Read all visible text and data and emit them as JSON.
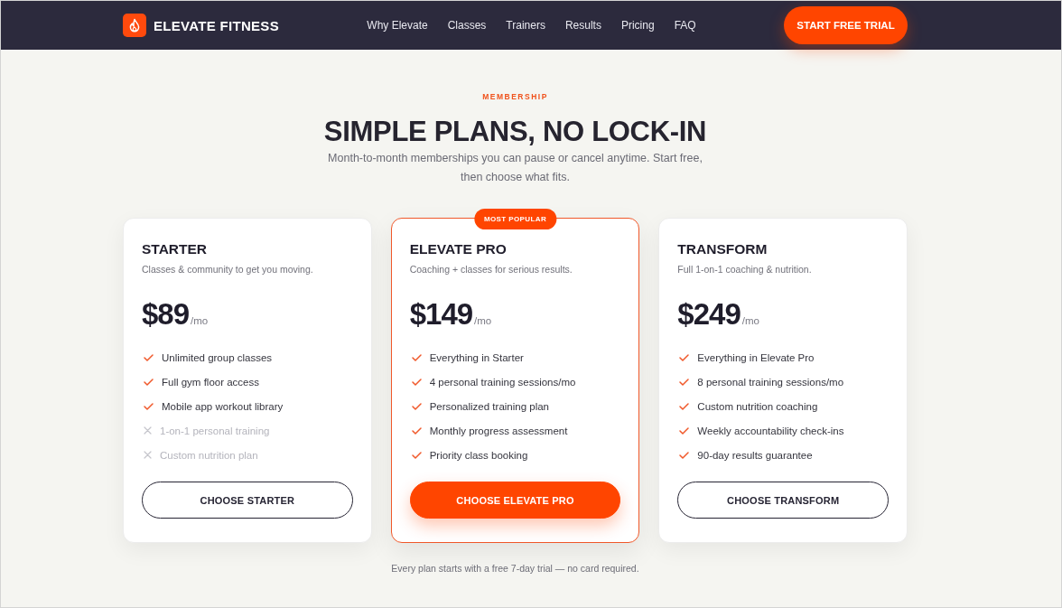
{
  "navbar": {
    "brand": "ELEVATE FITNESS",
    "links": [
      {
        "label": "Why Elevate"
      },
      {
        "label": "Classes"
      },
      {
        "label": "Trainers"
      },
      {
        "label": "Results"
      },
      {
        "label": "Pricing"
      },
      {
        "label": "FAQ"
      }
    ],
    "cta": "START FREE TRIAL"
  },
  "header": {
    "eyebrow": "MEMBERSHIP",
    "title": "SIMPLE PLANS, NO LOCK-IN",
    "subtitle": "Month-to-month memberships you can pause or cancel anytime. Start free, then choose what fits."
  },
  "plans": [
    {
      "name": "STARTER",
      "description": "Classes & community to get you moving.",
      "price": "$89",
      "period": "/mo",
      "featured": false,
      "features": [
        {
          "text": "Unlimited group classes",
          "included": true
        },
        {
          "text": "Full gym floor access",
          "included": true
        },
        {
          "text": "Mobile app workout library",
          "included": true
        },
        {
          "text": "1-on-1 personal training",
          "included": false
        },
        {
          "text": "Custom nutrition plan",
          "included": false
        }
      ],
      "button": "CHOOSE STARTER"
    },
    {
      "name": "ELEVATE PRO",
      "description": "Coaching + classes for serious results.",
      "price": "$149",
      "period": "/mo",
      "featured": true,
      "badge": "MOST POPULAR",
      "features": [
        {
          "text": "Everything in Starter",
          "included": true
        },
        {
          "text": "4 personal training sessions/mo",
          "included": true
        },
        {
          "text": "Personalized training plan",
          "included": true
        },
        {
          "text": "Monthly progress assessment",
          "included": true
        },
        {
          "text": "Priority class booking",
          "included": true
        }
      ],
      "button": "CHOOSE ELEVATE PRO"
    },
    {
      "name": "TRANSFORM",
      "description": "Full 1-on-1 coaching & nutrition.",
      "price": "$249",
      "period": "/mo",
      "featured": false,
      "features": [
        {
          "text": "Everything in Elevate Pro",
          "included": true
        },
        {
          "text": "8 personal training sessions/mo",
          "included": true
        },
        {
          "text": "Custom nutrition coaching",
          "included": true
        },
        {
          "text": "Weekly accountability check-ins",
          "included": true
        },
        {
          "text": "90-day results guarantee",
          "included": true
        }
      ],
      "button": "CHOOSE TRANSFORM"
    }
  ],
  "footnote": "Every plan starts with a free 7-day trial — no card required."
}
